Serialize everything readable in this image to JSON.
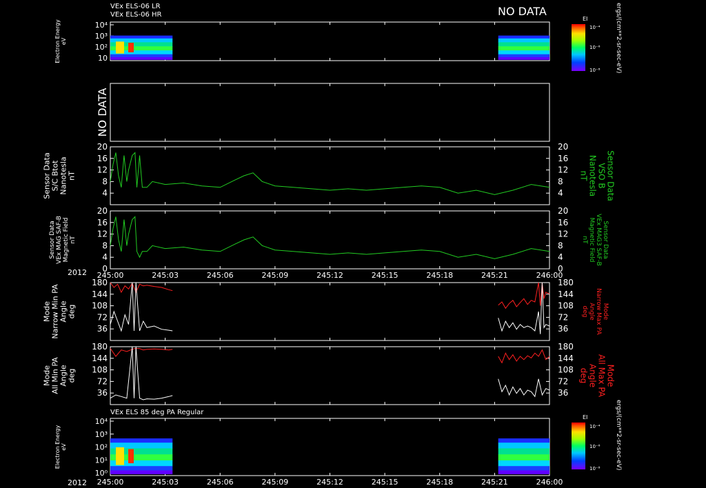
{
  "colors": {
    "background": "#000000",
    "axes": "#ffffff",
    "green_trace": "#22cc22",
    "red_trace": "#ff2020",
    "white_trace": "#ffffff",
    "right_label_green": "#22cc22",
    "right_label_red": "#ff2020"
  },
  "header": {
    "line1": "VEx ELS-06 LR",
    "line2": "VEx ELS-06 HR",
    "no_data_top": "NO DATA"
  },
  "bottom_header": "VEx ELS 85 deg PA Regular",
  "year": "2012",
  "colorbar": {
    "label": "EI",
    "ticks": [
      "10⁻⁴",
      "10⁻⁶",
      "10⁻⁸"
    ],
    "units": "ergs/(cm**2-sr-sec-eV)"
  },
  "chart_data": [
    {
      "type": "heatmap",
      "name": "panel-1",
      "ylabel": [
        "Electron Energy",
        "eV"
      ],
      "yscale": "log",
      "ylim": [
        1,
        10000
      ],
      "yticks": [
        "10⁴",
        "10³",
        "10²",
        "10"
      ],
      "data_segments": [
        {
          "x_start_min": 0,
          "x_end_min": 3.4
        },
        {
          "x_start_min": 21.2,
          "x_end_min": 24
        }
      ]
    },
    {
      "type": "line",
      "name": "panel-2",
      "no_data": "NO DATA"
    },
    {
      "type": "line",
      "name": "panel-3",
      "ylabel_left": [
        "Sensor Data",
        "S/C Btot",
        "Nanotesla",
        "nT"
      ],
      "ylabel_right": [
        "Sensor Data",
        "VSO B",
        "Nanotesla",
        "nT"
      ],
      "ylim": [
        0,
        20
      ],
      "yticks": [
        "20",
        "16",
        "12",
        "8",
        "4"
      ],
      "series": [
        {
          "color": "#22cc22",
          "shape": [
            [
              0,
              8
            ],
            [
              0.15,
              14
            ],
            [
              0.3,
              18
            ],
            [
              0.45,
              10
            ],
            [
              0.6,
              6
            ],
            [
              0.75,
              17
            ],
            [
              0.9,
              8
            ],
            [
              1.0,
              12
            ],
            [
              1.2,
              17
            ],
            [
              1.35,
              18
            ],
            [
              1.45,
              6
            ],
            [
              1.6,
              17
            ],
            [
              1.75,
              6
            ],
            [
              2.0,
              6
            ],
            [
              2.3,
              8
            ],
            [
              3,
              7
            ],
            [
              4,
              7.5
            ],
            [
              5,
              6.5
            ],
            [
              6,
              6
            ],
            [
              6.8,
              8.5
            ],
            [
              7.3,
              10
            ],
            [
              7.8,
              11
            ],
            [
              8.3,
              8
            ],
            [
              9,
              6.5
            ],
            [
              10,
              6
            ],
            [
              11,
              5.5
            ],
            [
              12,
              5
            ],
            [
              13,
              5.5
            ],
            [
              14,
              5
            ],
            [
              15,
              5.5
            ],
            [
              16,
              6
            ],
            [
              17,
              6.5
            ],
            [
              18,
              6
            ],
            [
              19,
              4
            ],
            [
              20,
              5
            ],
            [
              21,
              3.5
            ],
            [
              22,
              5
            ],
            [
              23,
              7
            ],
            [
              24,
              6
            ]
          ]
        }
      ]
    },
    {
      "type": "line",
      "name": "panel-4",
      "ylabel_left": [
        "Sensor Data",
        "VEx MAG SAF-B",
        "Magnetic Field",
        "nT"
      ],
      "ylabel_right": [
        "Sensor Data",
        "VEx MAG3 SAF-B",
        "Magnetic Field",
        "nT"
      ],
      "ylim": [
        0,
        20
      ],
      "yticks": [
        "20",
        "16",
        "12",
        "8",
        "4",
        "0"
      ],
      "series": [
        {
          "color": "#22cc22",
          "shape": [
            [
              0,
              8
            ],
            [
              0.15,
              14
            ],
            [
              0.3,
              18
            ],
            [
              0.45,
              10
            ],
            [
              0.6,
              6
            ],
            [
              0.75,
              17
            ],
            [
              0.9,
              8
            ],
            [
              1.0,
              12
            ],
            [
              1.2,
              17
            ],
            [
              1.35,
              18
            ],
            [
              1.45,
              6
            ],
            [
              1.6,
              4
            ],
            [
              1.75,
              6
            ],
            [
              2.0,
              6
            ],
            [
              2.3,
              8
            ],
            [
              3,
              7
            ],
            [
              4,
              7.5
            ],
            [
              5,
              6.5
            ],
            [
              6,
              6
            ],
            [
              6.8,
              8.5
            ],
            [
              7.3,
              10
            ],
            [
              7.8,
              11
            ],
            [
              8.3,
              8
            ],
            [
              9,
              6.5
            ],
            [
              10,
              6
            ],
            [
              11,
              5.5
            ],
            [
              12,
              5
            ],
            [
              13,
              5.5
            ],
            [
              14,
              5
            ],
            [
              15,
              5.5
            ],
            [
              16,
              6
            ],
            [
              17,
              6.5
            ],
            [
              18,
              6
            ],
            [
              19,
              4
            ],
            [
              20,
              5
            ],
            [
              21,
              3.5
            ],
            [
              22,
              5
            ],
            [
              23,
              7
            ],
            [
              24,
              6
            ]
          ]
        }
      ]
    },
    {
      "type": "line",
      "name": "panel-5",
      "ylabel_left": [
        "Mode",
        "Narrow Min PA",
        "Angle",
        "deg"
      ],
      "ylabel_right": [
        "Mode",
        "Narrow Max PA",
        "Angle",
        "deg"
      ],
      "ylim": [
        0,
        180
      ],
      "yticks": [
        "180",
        "144",
        "108",
        "72",
        "36"
      ],
      "series": [
        {
          "color": "#ff2020",
          "segments": [
            [
              [
                0,
                180
              ],
              [
                0.2,
                165
              ],
              [
                0.4,
                175
              ],
              [
                0.6,
                150
              ],
              [
                0.8,
                170
              ],
              [
                1.0,
                160
              ],
              [
                1.2,
                178
              ],
              [
                1.4,
                150
              ],
              [
                1.6,
                175
              ],
              [
                1.8,
                170
              ],
              [
                2.0,
                172
              ],
              [
                2.4,
                168
              ],
              [
                2.8,
                165
              ],
              [
                3.2,
                158
              ],
              [
                3.4,
                155
              ]
            ],
            [
              [
                21.2,
                110
              ],
              [
                21.4,
                120
              ],
              [
                21.6,
                100
              ],
              [
                21.8,
                115
              ],
              [
                22.0,
                125
              ],
              [
                22.2,
                105
              ],
              [
                22.4,
                118
              ],
              [
                22.6,
                130
              ],
              [
                22.8,
                112
              ],
              [
                23.0,
                125
              ],
              [
                23.2,
                120
              ],
              [
                23.4,
                180
              ],
              [
                23.5,
                108
              ],
              [
                23.6,
                180
              ],
              [
                23.7,
                130
              ],
              [
                23.8,
                150
              ],
              [
                24,
                145
              ]
            ]
          ]
        },
        {
          "color": "#ffffff",
          "segments": [
            [
              [
                0,
                50
              ],
              [
                0.2,
                90
              ],
              [
                0.4,
                60
              ],
              [
                0.6,
                30
              ],
              [
                0.8,
                80
              ],
              [
                1.0,
                50
              ],
              [
                1.2,
                180
              ],
              [
                1.3,
                30
              ],
              [
                1.4,
                180
              ],
              [
                1.6,
                30
              ],
              [
                1.8,
                60
              ],
              [
                2.0,
                40
              ],
              [
                2.4,
                45
              ],
              [
                2.8,
                35
              ],
              [
                3.2,
                32
              ],
              [
                3.4,
                30
              ]
            ],
            [
              [
                21.2,
                70
              ],
              [
                21.4,
                30
              ],
              [
                21.6,
                60
              ],
              [
                21.8,
                40
              ],
              [
                22.0,
                55
              ],
              [
                22.2,
                35
              ],
              [
                22.4,
                50
              ],
              [
                22.6,
                40
              ],
              [
                22.8,
                45
              ],
              [
                23.0,
                40
              ],
              [
                23.2,
                30
              ],
              [
                23.4,
                90
              ],
              [
                23.5,
                20
              ],
              [
                23.6,
                180
              ],
              [
                23.7,
                40
              ],
              [
                23.8,
                50
              ],
              [
                24,
                45
              ]
            ]
          ]
        }
      ]
    },
    {
      "type": "line",
      "name": "panel-6",
      "ylabel_left": [
        "Mode",
        "All Min PA",
        "Angle",
        "deg"
      ],
      "ylabel_right": [
        "Mode",
        "All Max PA",
        "Angle",
        "deg"
      ],
      "ylim": [
        0,
        180
      ],
      "yticks": [
        "180",
        "144",
        "108",
        "72",
        "36"
      ],
      "series": [
        {
          "color": "#ff2020",
          "segments": [
            [
              [
                0,
                175
              ],
              [
                0.3,
                150
              ],
              [
                0.6,
                170
              ],
              [
                0.9,
                165
              ],
              [
                1.2,
                172
              ],
              [
                1.4,
                175
              ],
              [
                1.6,
                174
              ],
              [
                1.8,
                170
              ],
              [
                2.0,
                172
              ],
              [
                2.4,
                173
              ],
              [
                2.8,
                172
              ],
              [
                3.2,
                170
              ],
              [
                3.4,
                172
              ]
            ],
            [
              [
                21.2,
                150
              ],
              [
                21.4,
                130
              ],
              [
                21.6,
                160
              ],
              [
                21.8,
                140
              ],
              [
                22.0,
                155
              ],
              [
                22.2,
                135
              ],
              [
                22.4,
                150
              ],
              [
                22.6,
                140
              ],
              [
                22.8,
                152
              ],
              [
                23.0,
                145
              ],
              [
                23.2,
                160
              ],
              [
                23.4,
                150
              ],
              [
                23.6,
                170
              ],
              [
                23.8,
                140
              ],
              [
                24,
                150
              ]
            ]
          ]
        },
        {
          "color": "#ffffff",
          "segments": [
            [
              [
                0,
                20
              ],
              [
                0.3,
                30
              ],
              [
                0.6,
                25
              ],
              [
                0.9,
                20
              ],
              [
                1.2,
                180
              ],
              [
                1.3,
                20
              ],
              [
                1.4,
                180
              ],
              [
                1.6,
                20
              ],
              [
                1.8,
                15
              ],
              [
                2.0,
                18
              ],
              [
                2.4,
                17
              ],
              [
                2.8,
                20
              ],
              [
                3.2,
                25
              ],
              [
                3.4,
                28
              ]
            ],
            [
              [
                21.2,
                80
              ],
              [
                21.4,
                40
              ],
              [
                21.6,
                60
              ],
              [
                21.8,
                30
              ],
              [
                22.0,
                55
              ],
              [
                22.2,
                35
              ],
              [
                22.4,
                50
              ],
              [
                22.6,
                30
              ],
              [
                22.8,
                45
              ],
              [
                23.0,
                40
              ],
              [
                23.2,
                25
              ],
              [
                23.4,
                80
              ],
              [
                23.6,
                30
              ],
              [
                23.8,
                50
              ],
              [
                24,
                45
              ]
            ]
          ]
        }
      ]
    },
    {
      "type": "heatmap",
      "name": "panel-7",
      "ylabel": [
        "Electron Energy",
        "eV"
      ],
      "yscale": "log",
      "ylim": [
        1,
        10000
      ],
      "yticks": [
        "10⁴",
        "10³",
        "10²",
        "10¹",
        "10⁰"
      ],
      "data_segments": [
        {
          "x_start_min": 0,
          "x_end_min": 3.4
        },
        {
          "x_start_min": 21.2,
          "x_end_min": 24
        }
      ]
    }
  ],
  "xaxis": {
    "ticks": [
      "245:00",
      "245:03",
      "245:06",
      "245:09",
      "245:12",
      "245:15",
      "245:18",
      "245:21",
      "246:00"
    ],
    "xlim_min": [
      0,
      24
    ]
  }
}
